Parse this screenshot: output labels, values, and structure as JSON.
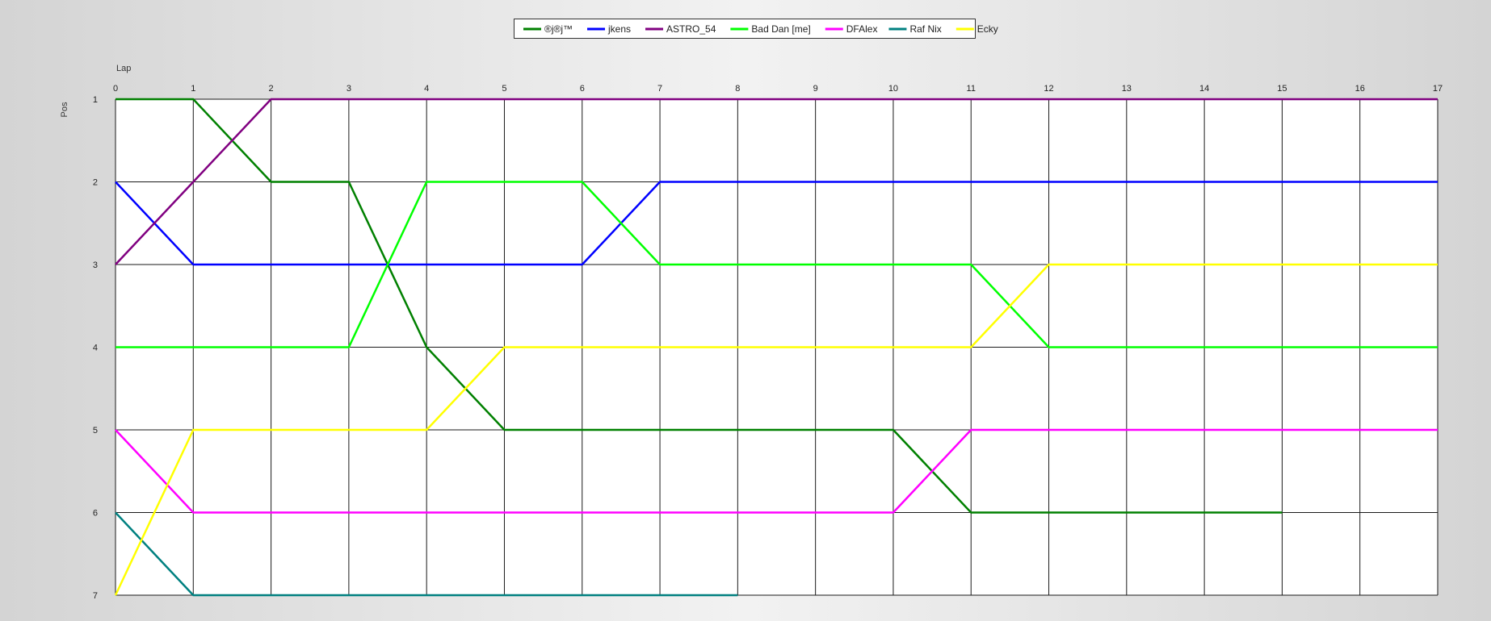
{
  "chart_data": {
    "type": "line",
    "xlabel": "Lap",
    "ylabel": "Pos",
    "xlim": [
      0,
      17
    ],
    "ylim": [
      1,
      7
    ],
    "y_inverted": true,
    "grid": true,
    "legend_position": "top-center",
    "x": [
      0,
      1,
      2,
      3,
      4,
      5,
      6,
      7,
      8,
      9,
      10,
      11,
      12,
      13,
      14,
      15,
      16,
      17
    ],
    "y_ticks": [
      1,
      2,
      3,
      4,
      5,
      6,
      7
    ],
    "series": [
      {
        "name": "®j®j™",
        "color": "#008000",
        "x": [
          0,
          1,
          2,
          3,
          4,
          5,
          6,
          7,
          8,
          9,
          10,
          11,
          12,
          13,
          14,
          15
        ],
        "values": [
          1,
          1,
          2,
          2,
          4,
          5,
          5,
          5,
          5,
          5,
          5,
          6,
          6,
          6,
          6,
          6
        ]
      },
      {
        "name": "jkens",
        "color": "#0000ff",
        "x": [
          0,
          1,
          2,
          3,
          4,
          5,
          6,
          7,
          8,
          9,
          10,
          11,
          12,
          13,
          14,
          15,
          16,
          17
        ],
        "values": [
          2,
          3,
          3,
          3,
          3,
          3,
          3,
          2,
          2,
          2,
          2,
          2,
          2,
          2,
          2,
          2,
          2,
          2
        ]
      },
      {
        "name": "ASTRO_54",
        "color": "#800080",
        "x": [
          0,
          1,
          2,
          3,
          4,
          5,
          6,
          7,
          8,
          9,
          10,
          11,
          12,
          13,
          14,
          15,
          16,
          17
        ],
        "values": [
          3,
          2,
          1,
          1,
          1,
          1,
          1,
          1,
          1,
          1,
          1,
          1,
          1,
          1,
          1,
          1,
          1,
          1
        ]
      },
      {
        "name": "Bad Dan [me]",
        "color": "#00ff00",
        "x": [
          0,
          1,
          2,
          3,
          4,
          5,
          6,
          7,
          8,
          9,
          10,
          11,
          12,
          13,
          14,
          15,
          16,
          17
        ],
        "values": [
          4,
          4,
          4,
          4,
          2,
          2,
          2,
          3,
          3,
          3,
          3,
          3,
          4,
          4,
          4,
          4,
          4,
          4
        ]
      },
      {
        "name": "DFAlex",
        "color": "#ff00ff",
        "x": [
          0,
          1,
          2,
          3,
          4,
          5,
          6,
          7,
          8,
          9,
          10,
          11,
          12,
          13,
          14,
          15,
          16,
          17
        ],
        "values": [
          5,
          6,
          6,
          6,
          6,
          6,
          6,
          6,
          6,
          6,
          6,
          5,
          5,
          5,
          5,
          5,
          5,
          5
        ]
      },
      {
        "name": "Raf Nix",
        "color": "#008080",
        "x": [
          0,
          1,
          2,
          3,
          4,
          5,
          6,
          7,
          8
        ],
        "values": [
          6,
          7,
          7,
          7,
          7,
          7,
          7,
          7,
          7
        ]
      },
      {
        "name": "Ecky",
        "color": "#ffff00",
        "x": [
          0,
          1,
          2,
          3,
          4,
          5,
          6,
          7,
          8,
          9,
          10,
          11,
          12,
          13,
          14,
          15,
          16,
          17
        ],
        "values": [
          7,
          5,
          5,
          5,
          5,
          4,
          4,
          4,
          4,
          4,
          4,
          4,
          3,
          3,
          3,
          3,
          3,
          3
        ]
      }
    ]
  }
}
